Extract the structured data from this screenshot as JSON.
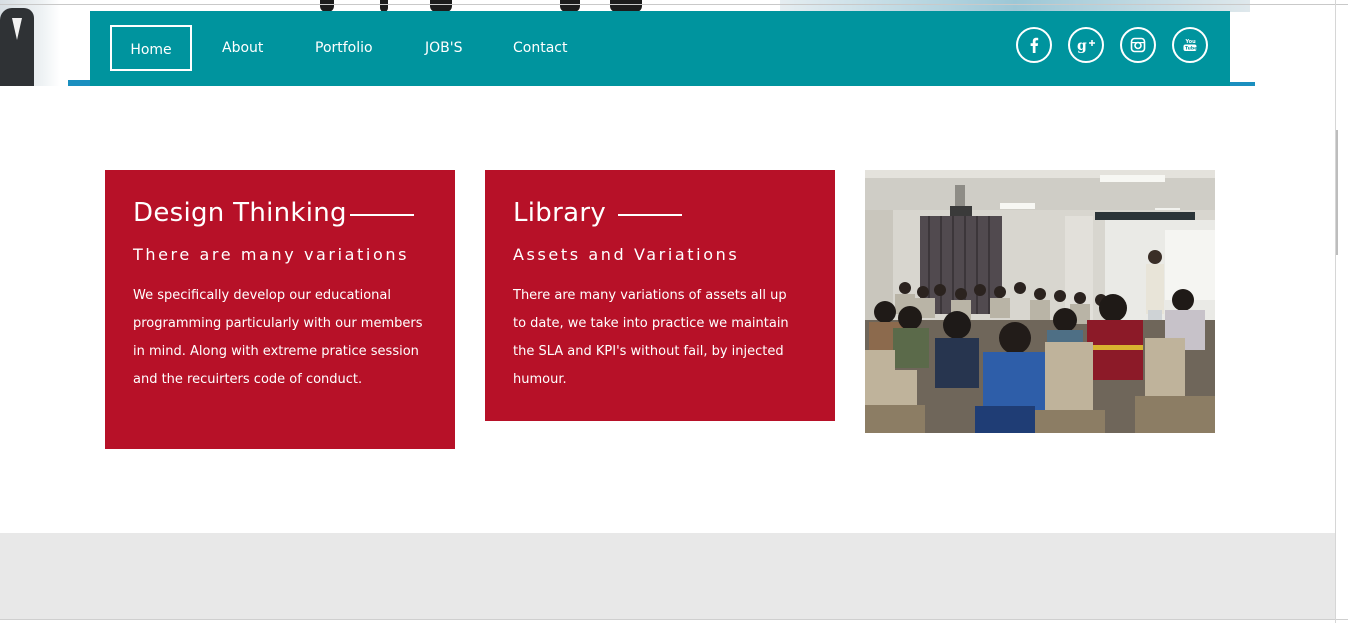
{
  "nav": {
    "items": [
      {
        "label": "Home",
        "active": true
      },
      {
        "label": "About",
        "active": false
      },
      {
        "label": "Portfolio",
        "active": false
      },
      {
        "label": "JOB'S",
        "active": false
      },
      {
        "label": "Contact",
        "active": false
      }
    ],
    "social_icons": [
      "facebook-icon",
      "google-plus-icon",
      "instagram-icon",
      "youtube-icon"
    ]
  },
  "cards": [
    {
      "title": "Design Thinking",
      "subtitle": "There are many variations",
      "body": "We specifically develop our educational programming particularly with our members in mind. Along with extreme pratice session and the recuirters code of conduct."
    },
    {
      "title": "Library",
      "subtitle": "Assets and Variations",
      "body": "There are many variations of assets all up to date, we take into practice we maintain the SLA and KPI's without fail, by injected humour."
    }
  ],
  "colors": {
    "nav_bg": "#00949e",
    "card_bg": "#b71128",
    "footer_bg": "#e8e8e8"
  }
}
